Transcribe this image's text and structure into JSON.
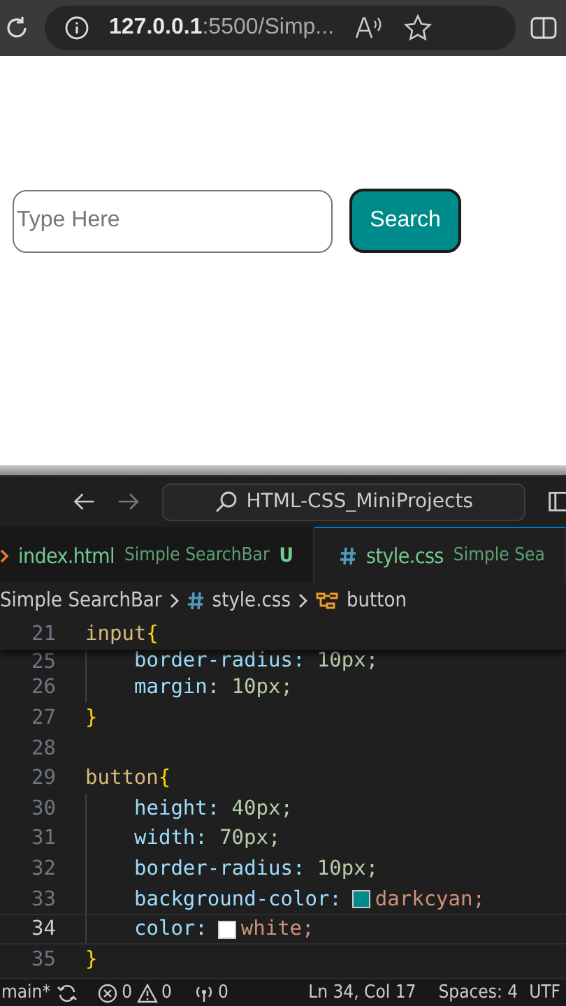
{
  "browser": {
    "url_host": "127.0.0.1",
    "url_path": ":5500/Simp..."
  },
  "page": {
    "search_field": {
      "placeholder": "Type Here"
    },
    "search_button": "Search"
  },
  "editor": {
    "command_center": "HTML-CSS_MiniProjects",
    "tabs": [
      {
        "kind": "html",
        "name": "index.html",
        "folder": "Simple SearchBar",
        "badge": "U",
        "selected": false
      },
      {
        "kind": "css",
        "name": "style.css",
        "folder": "Simple Sea",
        "selected": true
      }
    ],
    "breadcrumbs": [
      {
        "kind": "folder",
        "label": "Simple SearchBar"
      },
      {
        "kind": "css",
        "label": "style.css"
      },
      {
        "kind": "symbol",
        "label": "button"
      }
    ],
    "sticky_line": {
      "number": "21",
      "tokens": [
        {
          "kind": "selector",
          "text": "input"
        },
        {
          "kind": "brace",
          "text": "{"
        }
      ]
    },
    "lines": [
      {
        "number": "25",
        "current": false,
        "tokens": [
          {
            "kind": "property",
            "text": "border-radius:"
          },
          {
            "kind": "number",
            "text": "10px;"
          }
        ]
      },
      {
        "number": "26",
        "current": false,
        "tokens": [
          {
            "kind": "property",
            "text": "margin:"
          },
          {
            "kind": "number",
            "text": "10px;"
          }
        ]
      },
      {
        "number": "27",
        "current": false,
        "tokens": [
          {
            "kind": "brace",
            "text": "}"
          }
        ]
      },
      {
        "number": "28",
        "current": false
      },
      {
        "number": "29",
        "current": false,
        "tokens": [
          {
            "kind": "selector",
            "text": "button"
          },
          {
            "kind": "brace",
            "text": "{"
          }
        ]
      },
      {
        "number": "30",
        "current": false,
        "tokens": [
          {
            "kind": "property",
            "text": "height:"
          },
          {
            "kind": "number",
            "text": "40px;"
          }
        ]
      },
      {
        "number": "31",
        "current": false,
        "tokens": [
          {
            "kind": "property",
            "text": "width:"
          },
          {
            "kind": "number",
            "text": "70px;"
          }
        ]
      },
      {
        "number": "32",
        "current": false,
        "tokens": [
          {
            "kind": "property",
            "text": "border-radius:"
          },
          {
            "kind": "number",
            "text": "10px;"
          }
        ]
      },
      {
        "number": "33",
        "current": false,
        "tokens": [
          {
            "kind": "property",
            "text": "background-color:"
          },
          {
            "kind": "swatch",
            "color": "#008b8b"
          },
          {
            "kind": "value",
            "text": "darkcyan;"
          }
        ]
      },
      {
        "number": "34",
        "current": true,
        "tokens": [
          {
            "kind": "property",
            "text": "color:"
          },
          {
            "kind": "swatch",
            "color": "#ffffff"
          },
          {
            "kind": "value",
            "text": "white;"
          }
        ]
      },
      {
        "number": "35",
        "current": false,
        "tokens": [
          {
            "kind": "brace",
            "text": "}"
          }
        ]
      }
    ]
  },
  "status_bar": {
    "branch": "main*",
    "errors": "0",
    "warnings": "0",
    "ports": "0",
    "position": "Ln 34, Col 17",
    "spaces": "Spaces: 4",
    "encoding": "UTF"
  }
}
